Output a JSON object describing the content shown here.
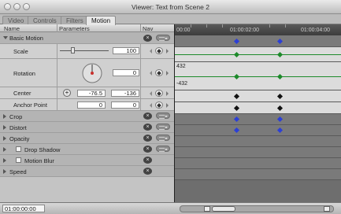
{
  "window": {
    "title": "Viewer: Text from Scene 2"
  },
  "tabs": [
    {
      "label": "Video",
      "active": false
    },
    {
      "label": "Controls",
      "active": false
    },
    {
      "label": "Filters",
      "active": false
    },
    {
      "label": "Motion",
      "active": true
    }
  ],
  "columns": {
    "name": "Name",
    "parameters": "Parameters",
    "nav": "Nav"
  },
  "ruler": {
    "labels": [
      "00:00",
      "01:00:02:00",
      "01:00:04:00"
    ]
  },
  "rows": [
    {
      "name": "Basic Motion",
      "kind": "header",
      "expanded": true
    },
    {
      "name": "Scale",
      "kind": "param",
      "value": "100",
      "slider_fraction": 0.3
    },
    {
      "name": "Rotation",
      "kind": "param",
      "value": "0",
      "graph_max": "432",
      "graph_min": "-432"
    },
    {
      "name": "Center",
      "kind": "param",
      "x": "-76.5",
      "y": "-136"
    },
    {
      "name": "Anchor Point",
      "kind": "param",
      "x": "0",
      "y": "0"
    },
    {
      "name": "Crop",
      "kind": "header",
      "expanded": false
    },
    {
      "name": "Distort",
      "kind": "header",
      "expanded": false
    },
    {
      "name": "Opacity",
      "kind": "header",
      "expanded": false
    },
    {
      "name": "Drop Shadow",
      "kind": "header",
      "expanded": false,
      "checkbox": true
    },
    {
      "name": "Motion Blur",
      "kind": "header",
      "expanded": false,
      "checkbox": true
    },
    {
      "name": "Speed",
      "kind": "header",
      "expanded": false
    }
  ],
  "timecode": "01:00:00:00",
  "colors": {
    "keyframe_blue": "#2c3fd6",
    "curve_green": "#1d8a2a",
    "timeline_bg": "#6e6e6e"
  },
  "icons": [
    "reset-x-icon",
    "menu-icon",
    "keyframe-nav-icon",
    "crosshair-icon",
    "rotation-dial-icon",
    "disclosure-triangle-icon"
  ]
}
